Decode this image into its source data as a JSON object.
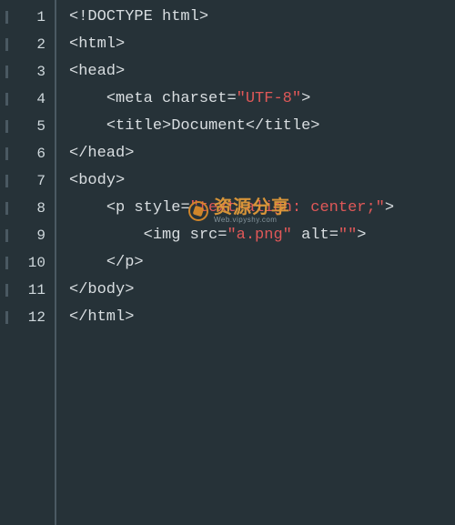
{
  "gutter": {
    "lines": [
      "1",
      "2",
      "3",
      "4",
      "5",
      "6",
      "7",
      "8",
      "9",
      "10",
      "11",
      "12"
    ]
  },
  "code": {
    "rows": [
      [
        {
          "t": "<!",
          "c": "punc"
        },
        {
          "t": "DOCTYPE",
          "c": "tag"
        },
        {
          "t": " ",
          "c": "punc"
        },
        {
          "t": "html",
          "c": "attr"
        },
        {
          "t": ">",
          "c": "punc"
        }
      ],
      [
        {
          "t": "<",
          "c": "punc"
        },
        {
          "t": "html",
          "c": "tag"
        },
        {
          "t": ">",
          "c": "punc"
        }
      ],
      [
        {
          "t": "<",
          "c": "punc"
        },
        {
          "t": "head",
          "c": "tag"
        },
        {
          "t": ">",
          "c": "punc"
        }
      ],
      [
        {
          "t": "    <",
          "c": "punc"
        },
        {
          "t": "meta",
          "c": "tag"
        },
        {
          "t": " ",
          "c": "punc"
        },
        {
          "t": "charset",
          "c": "attr"
        },
        {
          "t": "=",
          "c": "punc"
        },
        {
          "t": "\"UTF-8\"",
          "c": "str"
        },
        {
          "t": ">",
          "c": "punc"
        }
      ],
      [
        {
          "t": "    <",
          "c": "punc"
        },
        {
          "t": "title",
          "c": "tag"
        },
        {
          "t": ">",
          "c": "punc"
        },
        {
          "t": "Document",
          "c": "punc"
        },
        {
          "t": "</",
          "c": "punc"
        },
        {
          "t": "title",
          "c": "tag"
        },
        {
          "t": ">",
          "c": "punc"
        }
      ],
      [
        {
          "t": "</",
          "c": "punc"
        },
        {
          "t": "head",
          "c": "tag"
        },
        {
          "t": ">",
          "c": "punc"
        }
      ],
      [
        {
          "t": "<",
          "c": "punc"
        },
        {
          "t": "body",
          "c": "tag"
        },
        {
          "t": ">",
          "c": "punc"
        }
      ],
      [
        {
          "t": "    <",
          "c": "punc"
        },
        {
          "t": "p",
          "c": "tag"
        },
        {
          "t": " ",
          "c": "punc"
        },
        {
          "t": "style",
          "c": "attr"
        },
        {
          "t": "=",
          "c": "punc"
        },
        {
          "t": "\"text-align: center;\"",
          "c": "str"
        },
        {
          "t": ">",
          "c": "punc"
        }
      ],
      [
        {
          "t": "        <",
          "c": "punc"
        },
        {
          "t": "img",
          "c": "tag"
        },
        {
          "t": " ",
          "c": "punc"
        },
        {
          "t": "src",
          "c": "attr"
        },
        {
          "t": "=",
          "c": "punc"
        },
        {
          "t": "\"a.png\"",
          "c": "str"
        },
        {
          "t": " ",
          "c": "punc"
        },
        {
          "t": "alt",
          "c": "attr"
        },
        {
          "t": "=",
          "c": "punc"
        },
        {
          "t": "\"\"",
          "c": "str"
        },
        {
          "t": ">",
          "c": "punc"
        }
      ],
      [
        {
          "t": "    </",
          "c": "punc"
        },
        {
          "t": "p",
          "c": "tag"
        },
        {
          "t": ">",
          "c": "punc"
        }
      ],
      [
        {
          "t": "</",
          "c": "punc"
        },
        {
          "t": "body",
          "c": "tag"
        },
        {
          "t": ">",
          "c": "punc"
        }
      ],
      [
        {
          "t": "</",
          "c": "punc"
        },
        {
          "t": "html",
          "c": "tag"
        },
        {
          "t": ">",
          "c": "punc"
        }
      ]
    ]
  },
  "watermark": {
    "main": "资源分享",
    "sub": "Web.vipyshy.com"
  }
}
